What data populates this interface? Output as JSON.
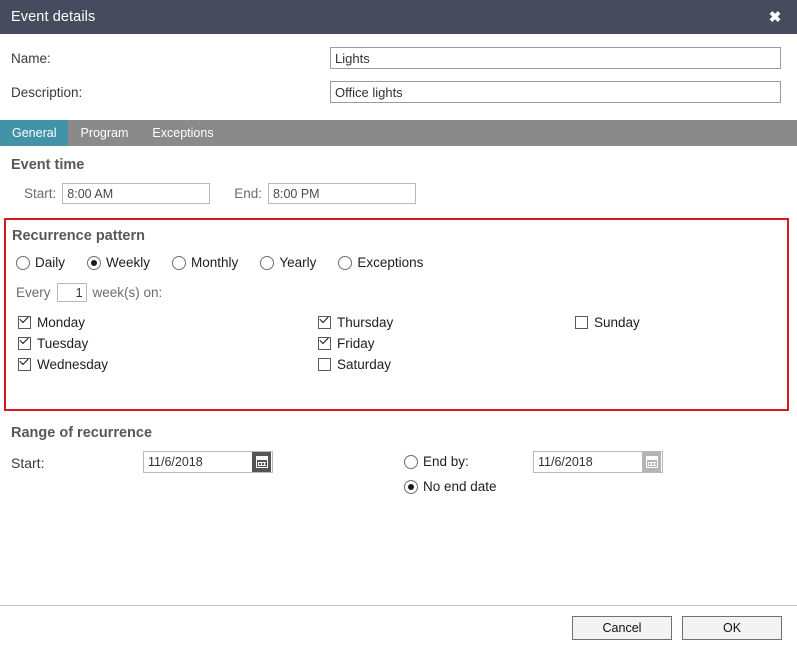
{
  "window": {
    "title": "Event details",
    "close_label": "✖"
  },
  "form": {
    "name_label": "Name:",
    "name_value": "Lights",
    "description_label": "Description:",
    "description_value": "Office lights"
  },
  "tabs": [
    {
      "label": "General",
      "active": true
    },
    {
      "label": "Program",
      "active": false
    },
    {
      "label": "Exceptions",
      "active": false
    }
  ],
  "event_time": {
    "heading": "Event time",
    "start_label": "Start:",
    "start_value": "8:00 AM",
    "end_label": "End:",
    "end_value": "8:00 PM"
  },
  "recurrence_pattern": {
    "heading": "Recurrence pattern",
    "highlight_color": "#d71920",
    "options": [
      {
        "label": "Daily",
        "selected": false
      },
      {
        "label": "Weekly",
        "selected": true
      },
      {
        "label": "Monthly",
        "selected": false
      },
      {
        "label": "Yearly",
        "selected": false
      },
      {
        "label": "Exceptions",
        "selected": false
      }
    ],
    "every_prefix": "Every",
    "interval_value": "1",
    "every_suffix": "week(s) on:",
    "days_col1": [
      {
        "label": "Monday",
        "checked": true
      },
      {
        "label": "Tuesday",
        "checked": true
      },
      {
        "label": "Wednesday",
        "checked": true
      }
    ],
    "days_col2": [
      {
        "label": "Thursday",
        "checked": true
      },
      {
        "label": "Friday",
        "checked": true
      },
      {
        "label": "Saturday",
        "checked": false
      }
    ],
    "days_col3": [
      {
        "label": "Sunday",
        "checked": false
      }
    ]
  },
  "range_of_recurrence": {
    "heading": "Range of recurrence",
    "start_label": "Start:",
    "start_date": "11/6/2018",
    "end_by_label": "End by:",
    "end_by_selected": false,
    "end_by_date": "11/6/2018",
    "no_end_date_label": "No end date",
    "no_end_date_selected": true
  },
  "footer": {
    "cancel_label": "Cancel",
    "ok_label": "OK"
  },
  "theme": {
    "titlebar": "#464b5e",
    "tab_active": "#4293a8",
    "tab_bar": "#8a8a8a"
  }
}
